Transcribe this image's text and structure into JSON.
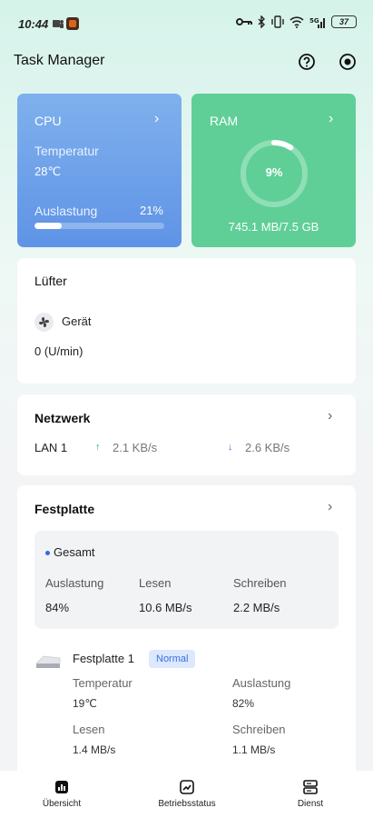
{
  "status_bar": {
    "time": "10:44",
    "battery": "37"
  },
  "header": {
    "title": "Task Manager",
    "help_icon": "help-circle-icon",
    "settings_icon": "record-icon"
  },
  "cpu": {
    "title": "CPU",
    "temperature_label": "Temperatur",
    "temperature_value": "28℃",
    "load_label": "Auslastung",
    "load_value": "21%",
    "load_fraction": 0.21
  },
  "ram": {
    "title": "RAM",
    "percent": "9%",
    "fraction": 0.09,
    "usage": "745.1 MB/7.5 GB"
  },
  "fan": {
    "title": "Lüfter",
    "device": "Gerät",
    "value": "0 (U/min)"
  },
  "network": {
    "title": "Netzwerk",
    "interface": "LAN 1",
    "upload": "2.1 KB/s",
    "download": "2.6 KB/s"
  },
  "disk": {
    "title": "Festplatte",
    "total": {
      "title": "Gesamt",
      "load_label": "Auslastung",
      "load_value": "84%",
      "read_label": "Lesen",
      "read_value": "10.6 MB/s",
      "write_label": "Schreiben",
      "write_value": "2.2 MB/s"
    },
    "drive": {
      "name": "Festplatte 1",
      "status": "Normal",
      "temp_label": "Temperatur",
      "temp_value": "19℃",
      "load_label": "Auslastung",
      "load_value": "82%",
      "read_label": "Lesen",
      "read_value": "1.4 MB/s",
      "write_label": "Schreiben",
      "write_value": "1.1 MB/s"
    }
  },
  "nav": [
    {
      "label": "Übersicht",
      "icon": "bar-chart-icon"
    },
    {
      "label": "Betriebsstatus",
      "icon": "trend-chart-icon"
    },
    {
      "label": "Dienst",
      "icon": "server-icon"
    }
  ],
  "colors": {
    "cpu_card": "#6a9fea",
    "ram_card": "#5fcf97",
    "accent_blue": "#2f6ae5",
    "up_green": "#1fb16e"
  }
}
